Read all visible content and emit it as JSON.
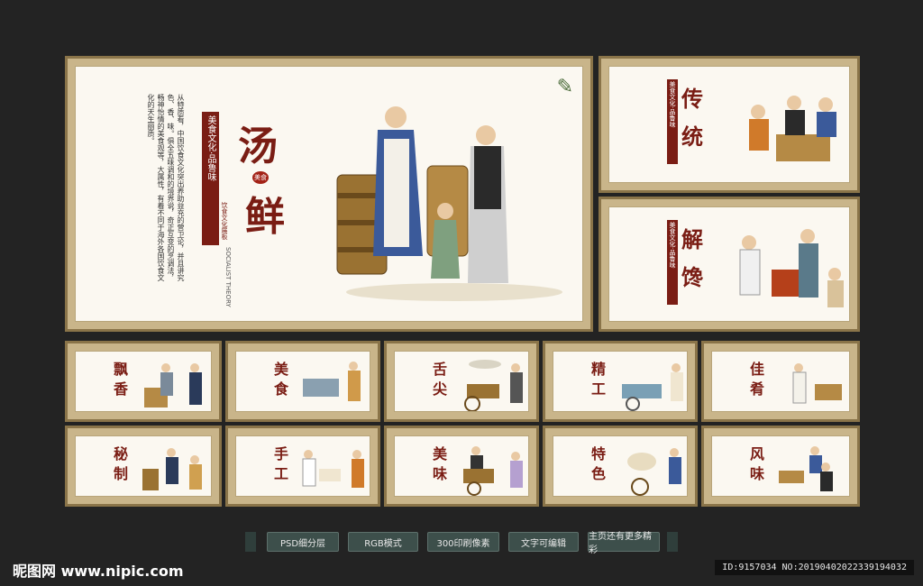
{
  "main_panel": {
    "title_chars": [
      "汤",
      "鲜"
    ],
    "seal": "美食",
    "vertical_title": "美食文化·品鲁味",
    "sub_vertical": "饮食文化展板",
    "english": "SOCIALIST THEORY",
    "body": "从特质看，中国饮食文化突出养助益充的营卫论，并且讲究色、香、味。俱全五味调和的境界说，奇正互变的烹调法，畅神怡情的美食观等，大属性，有着不同于海外各国饮食文化的天生丽质。"
  },
  "side_panels": [
    {
      "chars": [
        "传",
        "统"
      ],
      "vertical_title": "美食文化·品鲁味"
    },
    {
      "chars": [
        "解",
        "馋"
      ],
      "vertical_title": "美食文化·品鲁味"
    }
  ],
  "small_panels": [
    {
      "chars": [
        "飘",
        "香"
      ]
    },
    {
      "chars": [
        "美",
        "食"
      ]
    },
    {
      "chars": [
        "舌",
        "尖"
      ]
    },
    {
      "chars": [
        "精",
        "工"
      ]
    },
    {
      "chars": [
        "佳",
        "肴"
      ]
    },
    {
      "chars": [
        "秘",
        "制"
      ]
    },
    {
      "chars": [
        "手",
        "工"
      ]
    },
    {
      "chars": [
        "美",
        "味"
      ]
    },
    {
      "chars": [
        "特",
        "色"
      ]
    },
    {
      "chars": [
        "风",
        "味"
      ]
    }
  ],
  "buttons": [
    "PSD细分层",
    "RGB模式",
    "300印刷像素",
    "文字可编辑",
    "主页还有更多精彩"
  ],
  "footer": {
    "logo": "昵图网 www.nipic.com",
    "id": "ID:9157034 NO:20190402022339194032"
  },
  "colors": {
    "accent": "#7a1d14",
    "frame": "#c9b58a",
    "background": "#232323",
    "button": "#3d4f4b"
  }
}
